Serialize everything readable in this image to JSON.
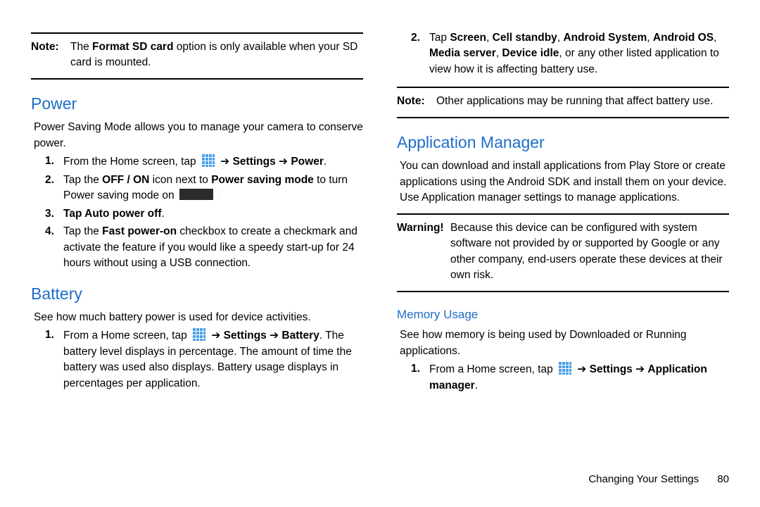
{
  "left": {
    "note_lbl": "Note:",
    "note_text_a": " The ",
    "note_bold": "Format SD card",
    "note_text_b": " option is only available when your SD card is mounted.",
    "power_h": "Power",
    "power_intro": "Power Saving Mode allows you to manage your camera to conserve power.",
    "p_steps": [
      {
        "n": "1.",
        "pre": "From the Home screen, tap ",
        "post_a": "Settings",
        "sep": " ➔ ",
        "post_b": "Power",
        "tail": "."
      },
      {
        "n": "2.",
        "pre": "Tap the ",
        "b1": "OFF / ON",
        "mid": " icon next to ",
        "b2": "Power saving mode",
        "mid2": " to turn Power saving mode on ",
        "tail": "."
      },
      {
        "n": "3.",
        "b_full": "Tap Auto power off",
        "tail": "."
      },
      {
        "n": "4.",
        "pre": "Tap the ",
        "b1": "Fast power-on",
        "mid": " checkbox to create a checkmark and activate the feature if you would like a speedy start-up for 24 hours without using a USB connection."
      }
    ],
    "battery_h": "Battery",
    "battery_intro": "See how much battery power is used for device activities.",
    "b_step_n": "1.",
    "b_step_pre": "From a Home screen, tap ",
    "b_step_a": "Settings",
    "b_step_sep": " ➔ ",
    "b_step_b": "Battery",
    "b_step_tail": ". The battery level displays in percentage. The amount of time the battery was used also displays. Battery usage displays in percentages per application."
  },
  "right": {
    "r_step_n": "2.",
    "r_step_pre": "Tap ",
    "r_step_b1": "Screen",
    "r_step_s1": ", ",
    "r_step_b2": "Cell standby",
    "r_step_s2": ", ",
    "r_step_b3": "Android System",
    "r_step_s3": ", ",
    "r_step_b4": "Android OS",
    "r_step_s4": ", ",
    "r_step_b5": "Media server",
    "r_step_s5": ", ",
    "r_step_b6": "Device idle",
    "r_step_tail": ", or any other listed application to view how it is affecting battery use.",
    "note_lbl": "Note:",
    "note_text": " Other applications may be running that affect battery use.",
    "am_h": "Application Manager",
    "am_intro": "You can download and install applications from Play Store or create applications using the Android SDK and install them on your device. Use Application manager settings to manage applications.",
    "warn_lbl": "Warning!",
    "warn_text": " Because this device can be configured with system software not provided by or supported by Google or any other company, end-users operate these devices at their own risk.",
    "mem_h": "Memory Usage",
    "mem_intro": "See how memory is being used by Downloaded or Running applications.",
    "mem_step_n": "1.",
    "mem_step_pre": "From a Home screen, tap ",
    "mem_step_a": "Settings",
    "mem_step_sep": " ➔ ",
    "mem_step_b": "Application manager",
    "mem_step_tail": ".",
    "footer_label": "Changing Your Settings",
    "footer_page": "80"
  }
}
